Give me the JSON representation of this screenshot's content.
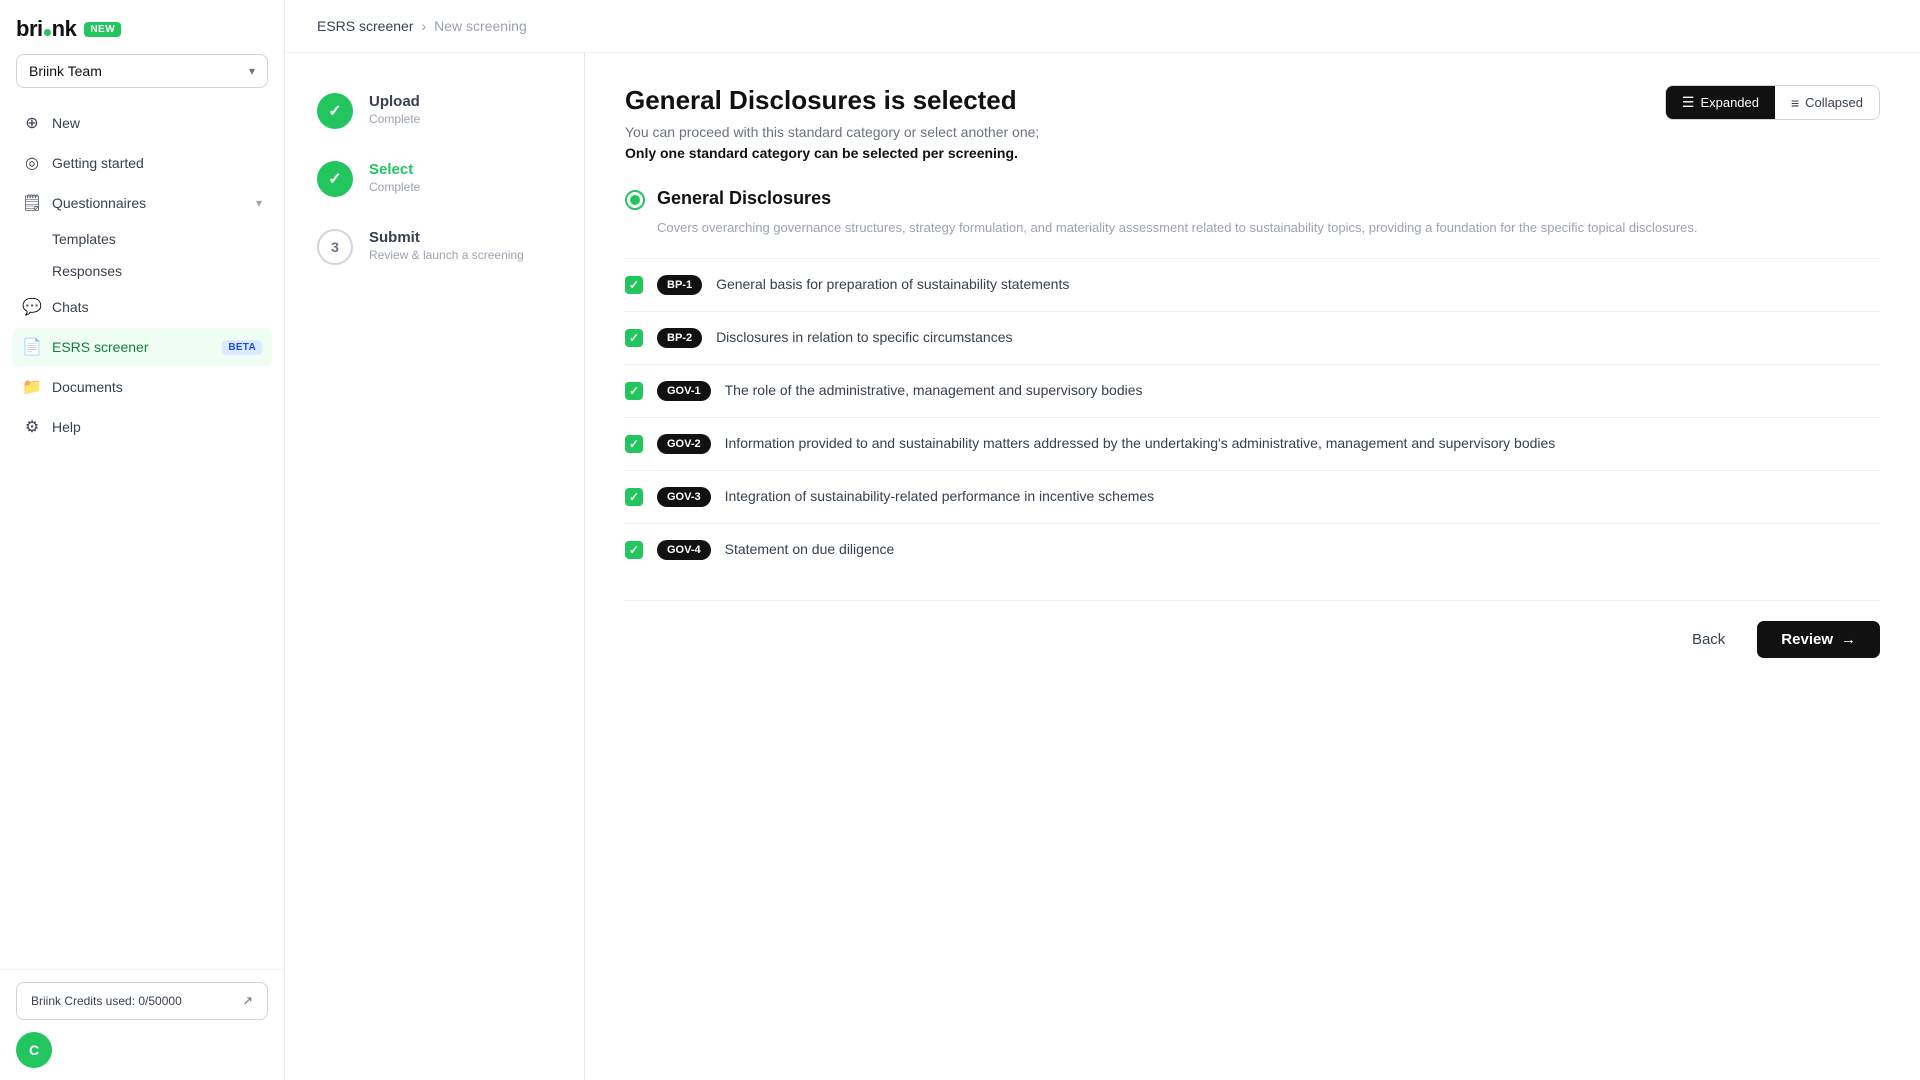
{
  "sidebar": {
    "logo": "briink",
    "new_badge": "NEW",
    "team_name": "Briink Team",
    "nav_items": [
      {
        "id": "new",
        "label": "New",
        "icon": "➕",
        "active": false
      },
      {
        "id": "getting-started",
        "label": "Getting started",
        "icon": "◎",
        "active": false
      },
      {
        "id": "questionnaires",
        "label": "Questionnaires",
        "icon": "🗒",
        "active": false,
        "has_chevron": true
      },
      {
        "id": "templates",
        "label": "Templates",
        "sub": true
      },
      {
        "id": "responses",
        "label": "Responses",
        "sub": true
      },
      {
        "id": "chats",
        "label": "Chats",
        "icon": "💬",
        "active": false
      },
      {
        "id": "esrs-screener",
        "label": "ESRS screener",
        "icon": "📄",
        "active": true,
        "beta": true
      },
      {
        "id": "documents",
        "label": "Documents",
        "icon": "📁",
        "active": false
      },
      {
        "id": "help",
        "label": "Help",
        "icon": "⚙",
        "active": false
      }
    ],
    "credits": "Briink Credits used: 0/50000",
    "avatar_initial": "C"
  },
  "breadcrumb": {
    "parent": "ESRS screener",
    "current": "New screening"
  },
  "steps": [
    {
      "id": "upload",
      "label": "Upload",
      "status": "Complete",
      "state": "complete"
    },
    {
      "id": "select",
      "label": "Select",
      "status": "Complete",
      "state": "complete",
      "active": true
    },
    {
      "id": "submit",
      "label": "Submit",
      "status": "Review & launch a screening",
      "state": "pending",
      "number": "3"
    }
  ],
  "main": {
    "title": "General Disclosures is selected",
    "description": "You can proceed with this standard category or select another one;",
    "description_bold": "Only one standard category can be selected per screening.",
    "view_toggle": {
      "expanded_label": "Expanded",
      "collapsed_label": "Collapsed",
      "active": "expanded"
    },
    "category": {
      "name": "General Disclosures",
      "description": "Covers overarching governance structures, strategy formulation, and materiality assessment related to sustainability topics, providing a foundation for the specific topical disclosures.",
      "selected": true
    },
    "items": [
      {
        "tag": "BP-1",
        "text": "General basis for preparation of sustainability statements",
        "checked": true
      },
      {
        "tag": "BP-2",
        "text": "Disclosures in relation to specific circumstances",
        "checked": true
      },
      {
        "tag": "GOV-1",
        "text": "The role of the administrative, management and supervisory bodies",
        "checked": true
      },
      {
        "tag": "GOV-2",
        "text": "Information provided to and sustainability matters addressed by the undertaking's administrative, management and supervisory bodies",
        "checked": true
      },
      {
        "tag": "GOV-3",
        "text": "Integration of sustainability-related performance in incentive schemes",
        "checked": true
      },
      {
        "tag": "GOV-4",
        "text": "Statement on due diligence",
        "checked": true
      }
    ],
    "back_label": "Back",
    "review_label": "Review"
  }
}
